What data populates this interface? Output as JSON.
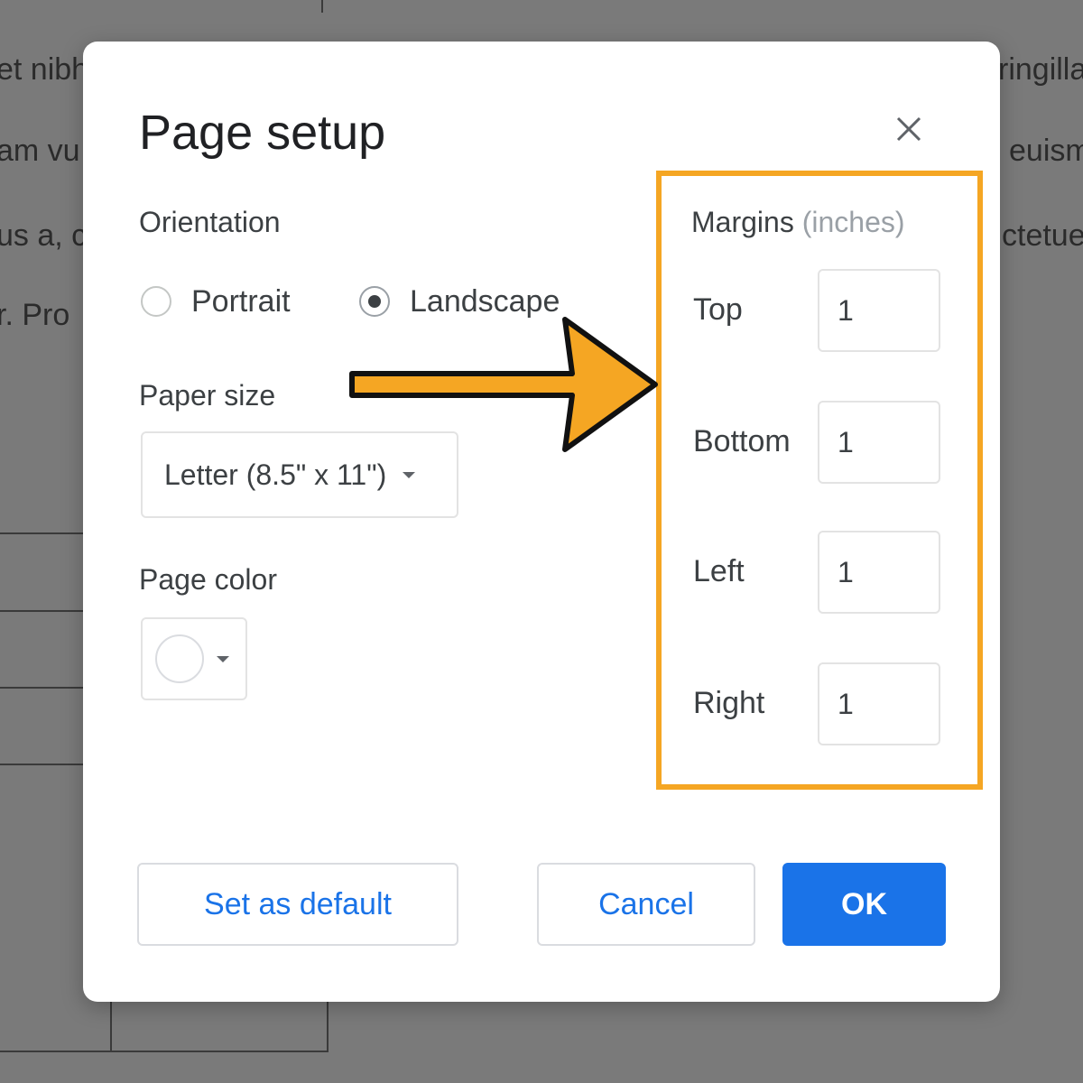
{
  "background_doc": {
    "fragments": [
      "et nibh",
      "am vu",
      "us a, c",
      "r. Pro",
      "ringilla",
      "euism",
      "ctetue"
    ]
  },
  "dialog": {
    "title": "Page setup",
    "close_icon": "close-icon",
    "orientation": {
      "label": "Orientation",
      "options": [
        {
          "label": "Portrait",
          "selected": false
        },
        {
          "label": "Landscape",
          "selected": true
        }
      ]
    },
    "paper_size": {
      "label": "Paper size",
      "selected": "Letter (8.5\" x 11\")"
    },
    "page_color": {
      "label": "Page color",
      "color": "#ffffff"
    },
    "margins": {
      "label": "Margins",
      "unit": "(inches)",
      "fields": [
        {
          "label": "Top",
          "value": "1"
        },
        {
          "label": "Bottom",
          "value": "1"
        },
        {
          "label": "Left",
          "value": "1"
        },
        {
          "label": "Right",
          "value": "1"
        }
      ]
    },
    "buttons": {
      "set_default": "Set as default",
      "cancel": "Cancel",
      "ok": "OK"
    }
  },
  "annotation": {
    "highlight_color": "#f5a623",
    "arrow_color": "#f5a623"
  }
}
